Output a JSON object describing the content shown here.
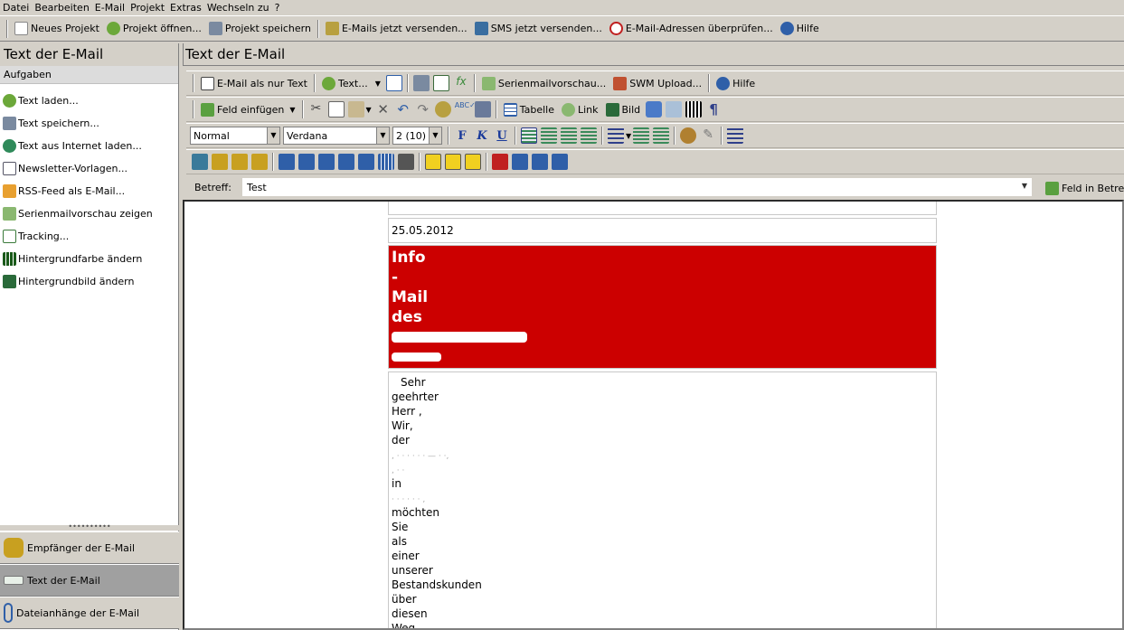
{
  "menu": [
    "Datei",
    "Bearbeiten",
    "E-Mail",
    "Projekt",
    "Extras",
    "Wechseln zu",
    "?"
  ],
  "main_toolbar": {
    "new_project": "Neues Projekt",
    "open_project": "Projekt öffnen...",
    "save_project": "Projekt speichern",
    "send_emails": "E-Mails jetzt versenden...",
    "send_sms": "SMS jetzt versenden...",
    "check_emails": "E-Mail-Adressen überprüfen...",
    "help": "Hilfe"
  },
  "left_panel": {
    "title": "Text der E-Mail",
    "subtitle": "Aufgaben",
    "tasks": [
      "Text laden...",
      "Text speichern...",
      "Text aus Internet laden...",
      "Newsletter-Vorlagen...",
      "RSS-Feed als E-Mail...",
      "Serienmailvorschau zeigen",
      "Tracking...",
      "Hintergrundfarbe ändern",
      "Hintergrundbild ändern"
    ],
    "nav": [
      "Empfänger der E-Mail",
      "Text der E-Mail",
      "Dateianhänge der E-Mail"
    ]
  },
  "right_panel": {
    "title": "Text der E-Mail",
    "toolbar1": {
      "as_text": "E-Mail als nur Text",
      "text": "Text...",
      "preview": "Serienmailvorschau...",
      "upload": "SWM Upload...",
      "help": "Hilfe"
    },
    "toolbar2": {
      "insert_field": "Feld einfügen",
      "table": "Tabelle",
      "link": "Link",
      "image": "Bild"
    },
    "format": {
      "style": "Normal",
      "font": "Verdana",
      "size": "2 (10)",
      "bold": "F",
      "italic": "K",
      "underline": "U"
    },
    "subject_label": "Betreff:",
    "subject_value": "Test",
    "field_in_subject": "Feld in Betref"
  },
  "editor": {
    "date": "25.05.2012",
    "header_lines": [
      "Info",
      "-",
      "Mail",
      "des"
    ],
    "body_lines": [
      "Sehr",
      "geehrter",
      "Herr ,",
      "Wir,",
      "der",
      "",
      "",
      "in",
      "",
      "möchten",
      "Sie",
      "als",
      "einer",
      "unserer",
      "Bestandskunden",
      "über",
      "diesen",
      "Weg"
    ]
  },
  "colors": {
    "chrome": "#d4d0c8",
    "header_red": "#cc0000",
    "active_nav": "#a0a0a0"
  }
}
